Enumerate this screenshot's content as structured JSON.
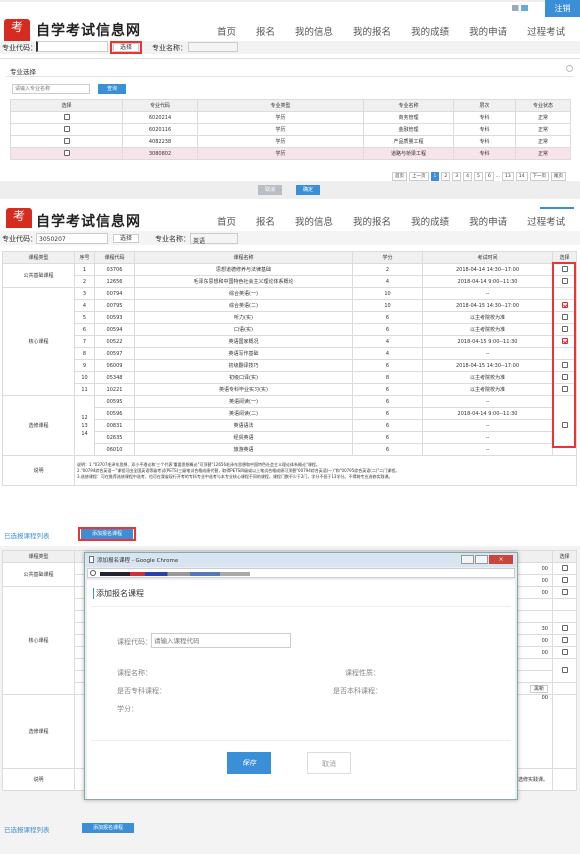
{
  "s1": {
    "logout": "注销",
    "logo": "自学考试信息网",
    "nav": [
      "首页",
      "报名",
      "我的信息",
      "我的报名",
      "我的成绩",
      "我的申请",
      "过程考试"
    ],
    "code_label": "专业代码：",
    "select_btn": "选择",
    "name_label": "专业名称："
  },
  "s2": {
    "title": "专业选择",
    "search_placeholder": "请输入专业名称",
    "search_btn": "查询",
    "headers": [
      "选择",
      "专业代码",
      "专业类型",
      "专业名称",
      "层次",
      "专业状态"
    ],
    "rows": [
      [
        "6020214",
        "学历",
        "商务管理",
        "专科",
        "正常"
      ],
      [
        "6020116",
        "学历",
        "金融管理",
        "专科",
        "正常"
      ],
      [
        "4082238",
        "学历",
        "产品质量工程",
        "专科",
        "正常"
      ],
      [
        "3080802",
        "学历",
        "道路与桥梁工程",
        "专科",
        "正常"
      ]
    ],
    "pager": [
      "首页",
      "上一页",
      "1",
      "2",
      "3",
      "4",
      "5",
      "6",
      "...",
      "13",
      "14",
      "下一页",
      "尾页"
    ],
    "cancel": "取消",
    "ok": "确定"
  },
  "s3": {
    "code_label": "专业代码：",
    "code_value": "3050207",
    "select_btn": "选择",
    "name_label": "专业名称：",
    "name_value": "英语",
    "headers": [
      "课程类型",
      "序号",
      "课程代码",
      "课程名称",
      "学分",
      "考试时间",
      "选择"
    ],
    "groups": [
      "公共基础课程",
      "核心课程",
      "选修课程"
    ],
    "rows": [
      [
        "1",
        "03706",
        "思想道德修养与法律基础",
        "2",
        "2018-04-14 14:30--17:00"
      ],
      [
        "2",
        "12656",
        "毛泽东思想和中国特色社会主义理论体系概论",
        "4",
        "2018-04-14 9:00--11:30"
      ],
      [
        "3",
        "00794",
        "综合英语(一)",
        "10",
        "--"
      ],
      [
        "4",
        "00795",
        "综合英语(二)",
        "10",
        "2018-04-15 14:30--17:00"
      ],
      [
        "5",
        "00593",
        "听力(实)",
        "6",
        "以主考院校为准"
      ],
      [
        "6",
        "00594",
        "口语(实)",
        "6",
        "以主考院校为准"
      ],
      [
        "7",
        "00522",
        "英语国家概况",
        "4",
        "2018-04-15 9:00--11:30"
      ],
      [
        "8",
        "00597",
        "英语写作基础",
        "4",
        "--"
      ],
      [
        "9",
        "06009",
        "初级翻译技巧",
        "6",
        "2018-04-15 14:30--17:00"
      ],
      [
        "10",
        "05348",
        "初级口译(实)",
        "8",
        "以主考院校为准"
      ],
      [
        "11",
        "10221",
        "英语专科毕业实习(实)",
        "6",
        "以主考院校为准"
      ],
      [
        "",
        "00595",
        "英语阅读(一)",
        "6",
        "--"
      ],
      [
        "12",
        "00596",
        "英语阅读(二)",
        "6",
        "2018-04-14 9:00--11:30"
      ],
      [
        "13",
        "00831",
        "英语语法",
        "6",
        "--"
      ],
      [
        "14",
        "02635",
        "经贸英语",
        "6",
        "--"
      ],
      [
        "",
        "06010",
        "旅游英语",
        "6",
        "--"
      ]
    ],
    "checked": [
      false,
      false,
      false,
      true,
      false,
      false,
      true,
      false,
      false,
      false,
      false,
      false,
      false
    ],
    "note_label": "说明",
    "note": [
      "说明：1.\"03707毛泽东思想、邓小平理论和'三个代表'重要思想概论\"可顶替\"12656毛泽东思想和中国特色社会主义理论体系概论\"课程。",
      "2.\"00794综合英语一\"课程可由全国英语等级考试(PETS)三级笔试合格成绩代替，取得PETS四级或以上笔试合格成绩可顶替\"00794综合英语(一)\"和\"00795综合英语(二)\"二门课程。",
      "3.选修课程：可在推荐选修课程中选考，也可在我省现行开考的专科专业中选考与本专业核心课程不同的课程，课程门数不少于2门，学分不低于13学分。不得跨专业选修实践课。"
    ],
    "selected_label": "已选报课程列表",
    "add_btn": "添加报名课程"
  },
  "s4": {
    "win_title": "添加报名课程 - Google Chrome",
    "heading": "添加报名课程",
    "code_label": "课程代码：",
    "code_placeholder": "请输入课程代码",
    "name_label": "课程名称：",
    "type_label": "课程性质：",
    "major_label": "是否专科课程：",
    "core_label": "是否本科课程：",
    "credit_label": "学分：",
    "save": "保存",
    "cancel": "取消",
    "bg_headers": [
      "课程类型",
      "选择"
    ],
    "bg_groups": [
      "公共基础课程",
      "核心课程",
      "选修课程"
    ],
    "bg_note": "说明",
    "bg_note_tail": "止选修实践课。",
    "bg_times": [
      "00",
      "00",
      "00",
      "30",
      "00",
      "00",
      "00"
    ],
    "bg_select": "黑新",
    "selected_label": "已选报课程列表",
    "add_btn": "添加报名课程"
  },
  "colors": {
    "accent": "#3a8fd6",
    "red": "#e33",
    "logo_red": "#d62b1f"
  }
}
